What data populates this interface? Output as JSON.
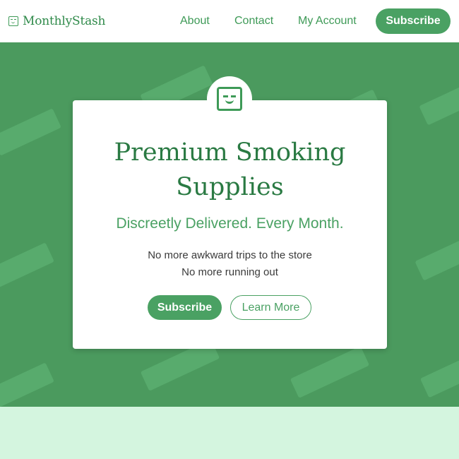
{
  "header": {
    "logo_text": "MonthlyStash",
    "nav": {
      "about": "About",
      "contact": "Contact",
      "account": "My Account"
    },
    "subscribe_label": "Subscribe"
  },
  "hero": {
    "title_line1": "Premium Smoking",
    "title_line2": "Supplies",
    "subtitle": "Discreetly Delivered. Every Month.",
    "line1": "No more awkward trips to the store",
    "line2": "No more running out",
    "subscribe_label": "Subscribe",
    "learn_more_label": "Learn More"
  },
  "colors": {
    "brand_green": "#4aa163",
    "hero_bg": "#4b9a5e",
    "band_bg": "#d4f5df"
  },
  "icons": {
    "logo": "smiley-box-icon",
    "badge": "smiley-box-icon"
  }
}
